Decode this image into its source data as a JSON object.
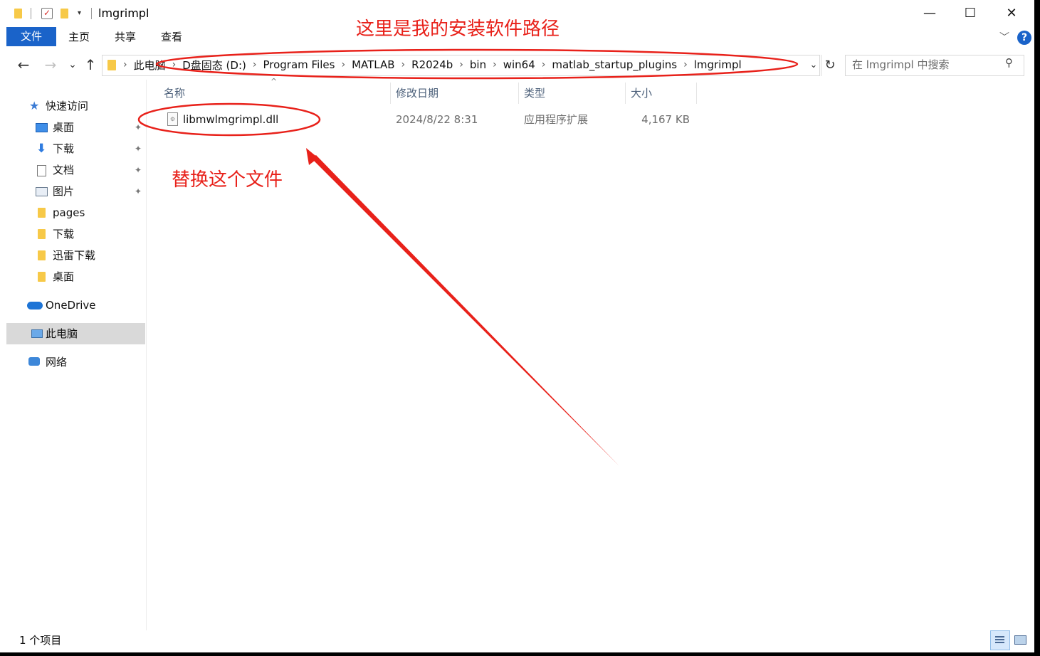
{
  "window": {
    "title": "lmgrimpl",
    "controls": {
      "minimize": "—",
      "maximize": "☐",
      "close": "✕"
    }
  },
  "quick_access": {
    "dropdown_glyph": "▾"
  },
  "ribbon": {
    "tabs": [
      "文件",
      "主页",
      "共享",
      "查看"
    ],
    "help_glyph": "?",
    "collapse_glyph": "﹀"
  },
  "nav": {
    "back_glyph": "←",
    "forward_glyph": "→",
    "recent_glyph": "⌄",
    "up_glyph": "↑",
    "breadcrumb": [
      "此电脑",
      "D盘固态 (D:)",
      "Program Files",
      "MATLAB",
      "R2024b",
      "bin",
      "win64",
      "matlab_startup_plugins",
      "lmgrimpl"
    ],
    "breadcrumb_separator": "›",
    "refresh_glyph": "↻",
    "search_placeholder": "在 lmgrimpl 中搜索",
    "search_glyph": "⚲"
  },
  "sidebar": {
    "items": [
      {
        "label": "快速访问",
        "icon": "star-icon",
        "pinned": false
      },
      {
        "label": "桌面",
        "icon": "desktop-icon",
        "pinned": true
      },
      {
        "label": "下载",
        "icon": "download-icon",
        "pinned": true
      },
      {
        "label": "文档",
        "icon": "document-icon",
        "pinned": true
      },
      {
        "label": "图片",
        "icon": "picture-icon",
        "pinned": true
      },
      {
        "label": "pages",
        "icon": "folder-icon",
        "pinned": false
      },
      {
        "label": "下载",
        "icon": "folder-icon",
        "pinned": false
      },
      {
        "label": "迅雷下载",
        "icon": "folder-icon",
        "pinned": false
      },
      {
        "label": "桌面",
        "icon": "folder-icon",
        "pinned": false
      },
      {
        "label": "OneDrive",
        "icon": "cloud-icon",
        "pinned": false
      },
      {
        "label": "此电脑",
        "icon": "computer-icon",
        "pinned": false,
        "selected": true
      },
      {
        "label": "网络",
        "icon": "network-icon",
        "pinned": false
      }
    ],
    "pin_glyph": "📌"
  },
  "file_list": {
    "columns": [
      "名称",
      "修改日期",
      "类型",
      "大小"
    ],
    "sort_glyph": "^",
    "rows": [
      {
        "name": "libmwlmgrimpl.dll",
        "modified": "2024/8/22 8:31",
        "type": "应用程序扩展",
        "size": "4,167 KB"
      }
    ]
  },
  "status_bar": {
    "item_count": "1 个项目"
  },
  "annotations": {
    "path_note": "这里是我的安装软件路径",
    "file_note": "替换这个文件",
    "color": "#e8211a"
  }
}
